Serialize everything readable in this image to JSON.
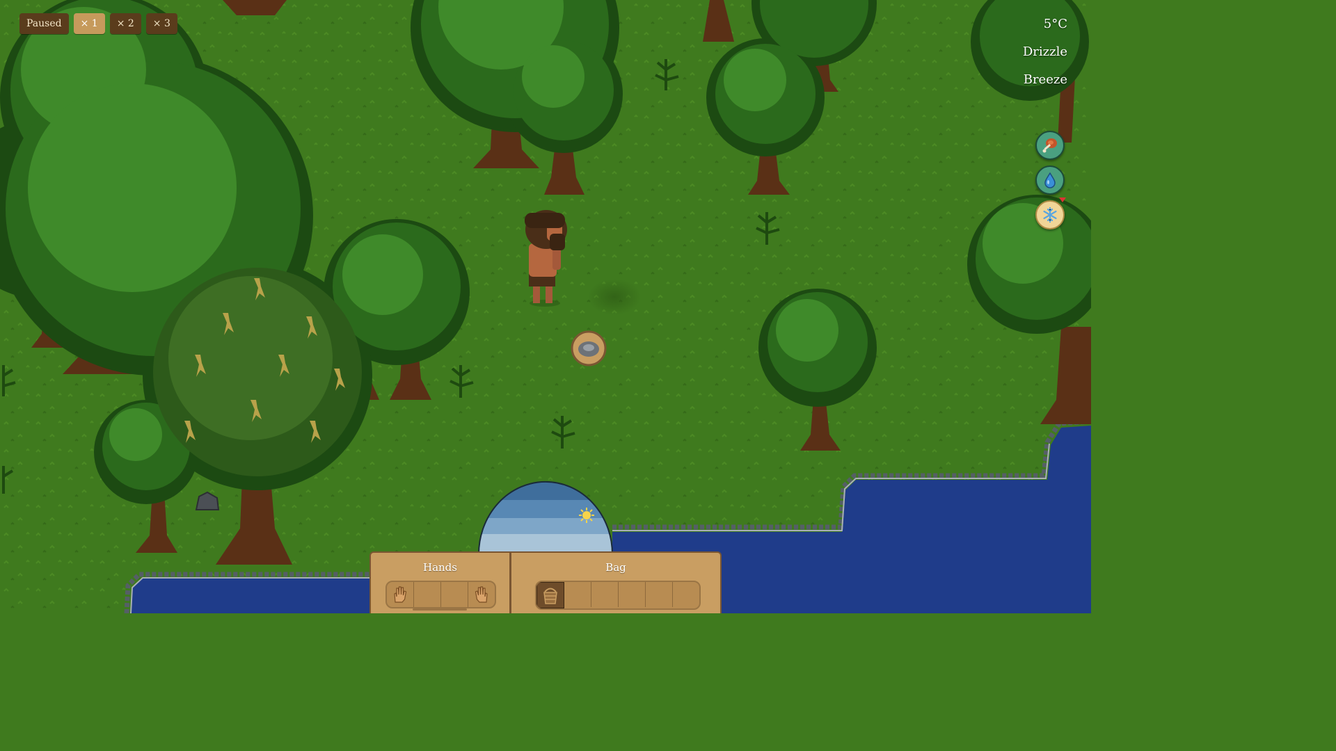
{
  "speed_controls": {
    "paused_label": "Paused",
    "speed_1_label": "× 1",
    "speed_2_label": "× 2",
    "speed_3_label": "× 3",
    "active": "× 1"
  },
  "weather": {
    "temperature": "5°C",
    "precipitation": "Drizzle",
    "wind": "Breeze"
  },
  "needs": [
    {
      "name": "hunger",
      "icon": "meat-drumstick-icon"
    },
    {
      "name": "thirst",
      "icon": "water-drop-icon"
    },
    {
      "name": "warmth",
      "icon": "snowflake-icon",
      "alert": true
    }
  ],
  "inventory": {
    "hands_label": "Hands",
    "bag_label": "Bag",
    "hand_slots": [
      "left-hand-icon",
      "",
      "",
      "right-hand-icon"
    ],
    "bag_slots": [
      "basket-icon",
      "",
      "",
      "",
      "",
      "",
      ""
    ]
  },
  "colors": {
    "grass": "#3f7a1e",
    "water": "#1f3c8a",
    "panel": "#c99e62",
    "panel_border": "#7a5632",
    "button": "#5a3c1c",
    "button_active": "#c69a5c"
  }
}
